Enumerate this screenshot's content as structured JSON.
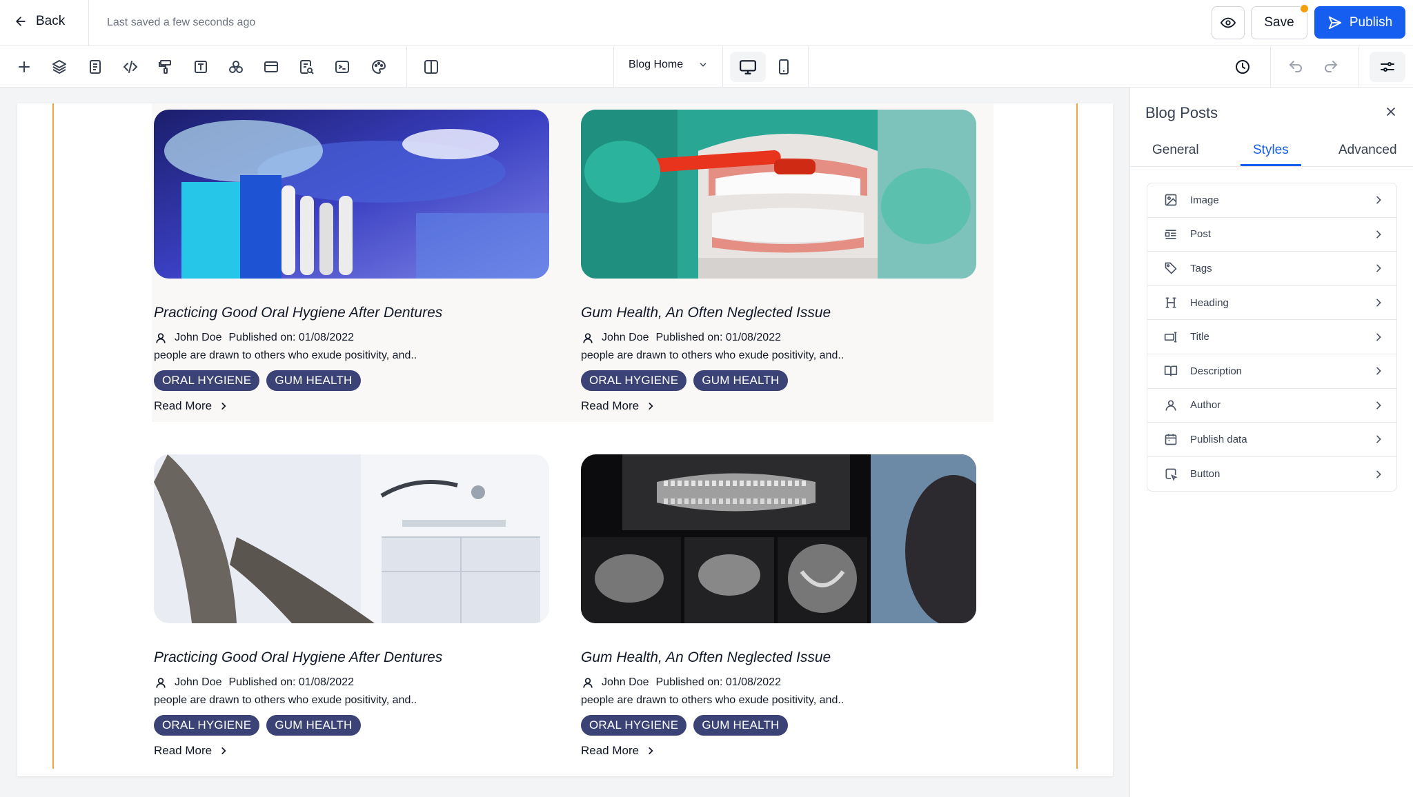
{
  "topbar": {
    "back_label": "Back",
    "saved_status": "Last saved a few seconds ago",
    "save_label": "Save",
    "publish_label": "Publish"
  },
  "toolbar": {
    "tools": [
      "add-icon",
      "layers-icon",
      "pages-icon",
      "code-icon",
      "paint-roller-icon",
      "text-icon",
      "components-icon",
      "section-icon",
      "search-doc-icon",
      "terminal-icon",
      "palette-icon",
      "columns-icon"
    ],
    "page_select": "Blog Home"
  },
  "posts": [
    {
      "title": "Practicing Good Oral Hygiene After Dentures",
      "author": "John Doe",
      "published": "Published on: 01/08/2022",
      "excerpt": "people are drawn to others who exude positivity, and..",
      "tags": [
        "ORAL HYGIENE",
        "GUM HEALTH"
      ],
      "read_more": "Read More",
      "image": "toothbrush-photo"
    },
    {
      "title": "Gum Health, An Often Neglected Issue",
      "author": "John Doe",
      "published": "Published on: 01/08/2022",
      "excerpt": "people are drawn to others who exude positivity, and..",
      "tags": [
        "ORAL HYGIENE",
        "GUM HEALTH"
      ],
      "read_more": "Read More",
      "image": "denture-model-photo"
    },
    {
      "title": "Practicing Good Oral Hygiene After Dentures",
      "author": "John Doe",
      "published": "Published on: 01/08/2022",
      "excerpt": "people are drawn to others who exude positivity, and..",
      "tags": [
        "ORAL HYGIENE",
        "GUM HEALTH"
      ],
      "read_more": "Read More",
      "image": "dental-chair-photo"
    },
    {
      "title": "Gum Health, An Often Neglected Issue",
      "author": "John Doe",
      "published": "Published on: 01/08/2022",
      "excerpt": "people are drawn to others who exude positivity, and..",
      "tags": [
        "ORAL HYGIENE",
        "GUM HEALTH"
      ],
      "read_more": "Read More",
      "image": "dental-xray-photo"
    }
  ],
  "panel": {
    "title": "Blog Posts",
    "tabs": [
      "General",
      "Styles",
      "Advanced"
    ],
    "active_tab": "Styles",
    "items": [
      {
        "label": "Image",
        "icon": "image-icon"
      },
      {
        "label": "Post",
        "icon": "post-icon"
      },
      {
        "label": "Tags",
        "icon": "tag-icon"
      },
      {
        "label": "Heading",
        "icon": "heading-icon"
      },
      {
        "label": "Title",
        "icon": "title-icon"
      },
      {
        "label": "Description",
        "icon": "book-icon"
      },
      {
        "label": "Author",
        "icon": "user-icon"
      },
      {
        "label": "Publish data",
        "icon": "calendar-icon"
      },
      {
        "label": "Button",
        "icon": "button-icon"
      }
    ]
  },
  "colors": {
    "accent": "#155eef",
    "tag_bg": "#3b4275",
    "guide": "#f4a340",
    "unsaved_dot": "#f59e0b"
  }
}
